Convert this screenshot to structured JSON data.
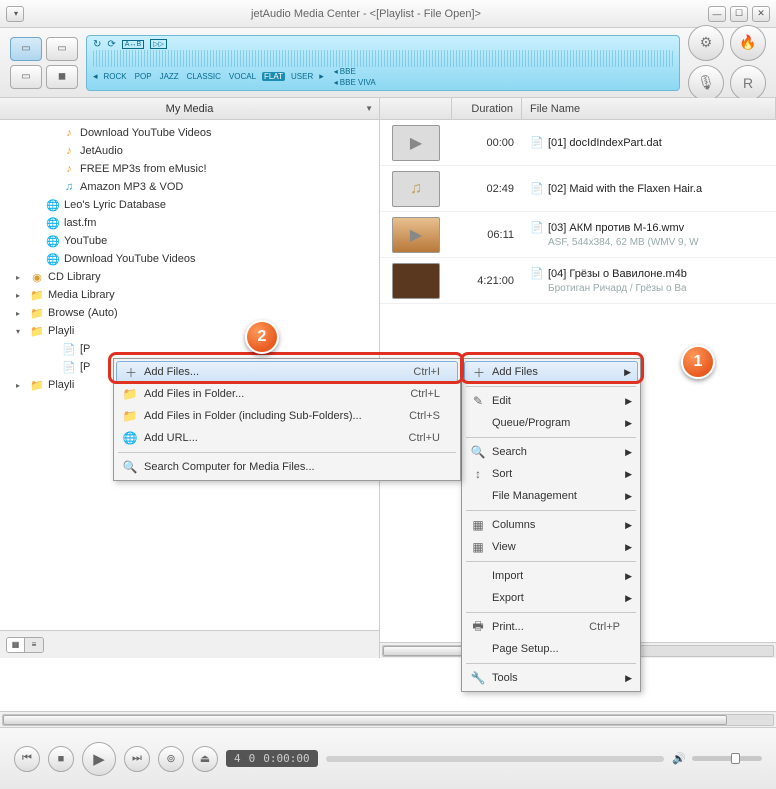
{
  "title": "jetAudio Media Center - <[Playlist - File Open]>",
  "sidebar": {
    "header": "My Media",
    "items": [
      {
        "label": "Download YouTube Videos",
        "cls": "note"
      },
      {
        "label": "JetAudio",
        "cls": "note"
      },
      {
        "label": "FREE MP3s from eMusic!",
        "cls": "note"
      },
      {
        "label": "Amazon MP3 & VOD",
        "cls": "note2"
      },
      {
        "label": "Leo's Lyric Database",
        "cls": "globe",
        "lvl": "l1"
      },
      {
        "label": "last.fm",
        "cls": "globe",
        "lvl": "l1"
      },
      {
        "label": "YouTube",
        "cls": "globe",
        "lvl": "l1"
      },
      {
        "label": "Download YouTube Videos",
        "cls": "globe",
        "lvl": "l1"
      },
      {
        "label": "CD Library",
        "cls": "disc",
        "lvl": "l0",
        "tri": "▸"
      },
      {
        "label": "Media Library",
        "cls": "folder",
        "lvl": "l0",
        "tri": "▸"
      },
      {
        "label": "Browse (Auto)",
        "cls": "folder",
        "lvl": "l0",
        "tri": "▸"
      },
      {
        "label": "Playli",
        "cls": "folder",
        "lvl": "l0",
        "tri": "▾"
      },
      {
        "label": "[P",
        "cls": "doc",
        "lvl": "l1p"
      },
      {
        "label": "[P",
        "cls": "doc",
        "lvl": "l1p"
      },
      {
        "label": "Playli",
        "cls": "folder",
        "lvl": "l0",
        "tri": "▸"
      }
    ]
  },
  "columns": {
    "dur": "Duration",
    "fn": "File Name"
  },
  "rows": [
    {
      "dur": "00:00",
      "name": "[01] docIdIndexPart.dat",
      "thumb": "vid",
      "sub": ""
    },
    {
      "dur": "02:49",
      "name": "[02] Maid with the Flaxen Hair.a",
      "thumb": "mus",
      "sub": ""
    },
    {
      "dur": "06:11",
      "name": "[03] АКМ против М-16.wmv",
      "thumb": "vid1",
      "sub": "ASF, 544x384, 62 MB (WMV 9, W"
    },
    {
      "dur": "4:21:00",
      "name": "[04] Грёзы о Вавилоне.m4b",
      "thumb": "vid2",
      "sub": "Бротиган Ричард / Грёзы о Ва"
    }
  ],
  "submenu": {
    "items": [
      {
        "label": "Add Files...",
        "short": "Ctrl+I",
        "ico": "＋"
      },
      {
        "label": "Add Files in Folder...",
        "short": "Ctrl+L",
        "ico": "📁"
      },
      {
        "label": "Add Files in Folder (including Sub-Folders)...",
        "short": "Ctrl+S",
        "ico": "📁"
      },
      {
        "label": "Add URL...",
        "short": "Ctrl+U",
        "ico": "🌐"
      },
      {
        "label": "Search Computer for Media Files...",
        "short": "",
        "ico": "🔍"
      }
    ]
  },
  "menu": {
    "groups": [
      [
        {
          "label": "Add Files",
          "arrow": true,
          "ico": "＋"
        }
      ],
      [
        {
          "label": "Edit",
          "arrow": true,
          "ico": "✎"
        },
        {
          "label": "Queue/Program",
          "arrow": true,
          "ico": ""
        }
      ],
      [
        {
          "label": "Search",
          "arrow": true,
          "ico": "🔍"
        },
        {
          "label": "Sort",
          "arrow": true,
          "ico": "↕"
        },
        {
          "label": "File Management",
          "arrow": true,
          "ico": ""
        }
      ],
      [
        {
          "label": "Columns",
          "arrow": true,
          "ico": "▦"
        },
        {
          "label": "View",
          "arrow": true,
          "ico": "▦"
        }
      ],
      [
        {
          "label": "Import",
          "arrow": true,
          "ico": ""
        },
        {
          "label": "Export",
          "arrow": true,
          "ico": ""
        }
      ],
      [
        {
          "label": "Print...",
          "short": "Ctrl+P",
          "ico": "🖶"
        },
        {
          "label": "Page Setup...",
          "ico": ""
        }
      ],
      [
        {
          "label": "Tools",
          "arrow": true,
          "ico": "🔧"
        }
      ]
    ]
  },
  "eq": [
    "ROCK",
    "POP",
    "JAZZ",
    "CLASSIC",
    "VOCAL",
    "FLAT",
    "USER"
  ],
  "eq_active": "FLAT",
  "bbe": {
    "a": "BBE",
    "b": "BBE VIVA"
  },
  "play": {
    "track": "4",
    "idx": "0",
    "time": "0:00:00"
  },
  "callouts": {
    "one": "1",
    "two": "2"
  }
}
